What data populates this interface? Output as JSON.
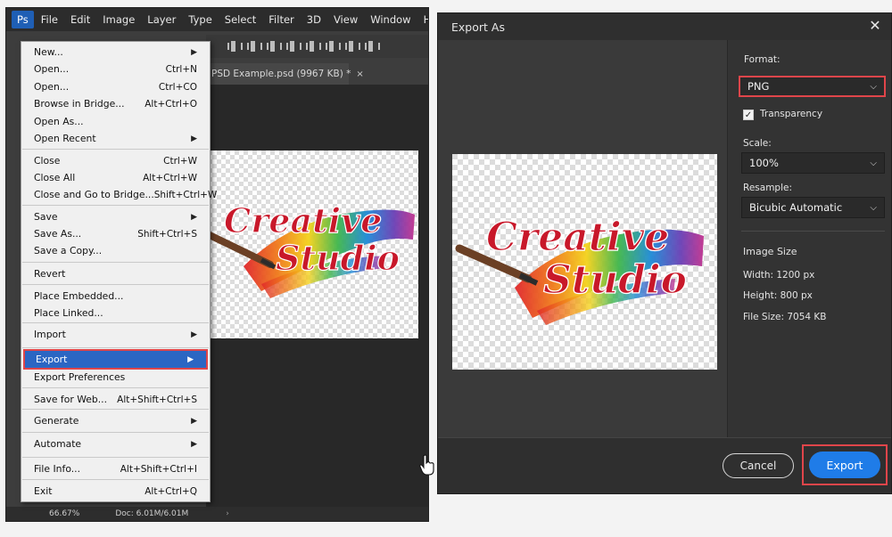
{
  "photoshop": {
    "menubar": [
      "Ps",
      "File",
      "Edit",
      "Image",
      "Layer",
      "Type",
      "Select",
      "Filter",
      "3D",
      "View",
      "Window",
      "Help"
    ],
    "document_tab": {
      "title": "PSD Example.psd (9967 KB) *",
      "close": "×"
    },
    "status": {
      "zoom": "66.67%",
      "doc": "Doc: 6.01M/6.01M",
      "arrow": "›"
    },
    "file_menu": [
      {
        "label": "New...",
        "shortcut": "",
        "submenu": true
      },
      {
        "label": "Open...",
        "shortcut": "Ctrl+N"
      },
      {
        "label": "Open...",
        "shortcut": "Ctrl+CO"
      },
      {
        "label": "Browse in Bridge...",
        "shortcut": "Alt+Ctrl+O"
      },
      {
        "label": "Open As...",
        "shortcut": ""
      },
      {
        "label": "Open Recent",
        "shortcut": "",
        "submenu": true
      },
      {
        "label": "Close",
        "shortcut": "Ctrl+W"
      },
      {
        "label": "Close All",
        "shortcut": "Alt+Ctrl+W"
      },
      {
        "label": "Close and Go to Bridge...",
        "shortcut": "Shift+Ctrl+W"
      },
      {
        "label": "Save",
        "shortcut": "",
        "submenu": true
      },
      {
        "label": "Save As...",
        "shortcut": "Shift+Ctrl+S"
      },
      {
        "label": "Save a Copy...",
        "shortcut": ""
      },
      {
        "label": "Revert",
        "shortcut": ""
      },
      {
        "label": "Place Embedded...",
        "shortcut": ""
      },
      {
        "label": "Place Linked...",
        "shortcut": ""
      },
      {
        "label": "Import",
        "shortcut": "",
        "submenu": true
      },
      {
        "label": "Export",
        "shortcut": "",
        "submenu": true,
        "highlighted": true
      },
      {
        "label": "Export Preferences",
        "shortcut": ""
      },
      {
        "label": "Save for Web...",
        "shortcut": "Alt+Shift+Ctrl+S"
      },
      {
        "label": "Generate",
        "shortcut": "",
        "submenu": true
      },
      {
        "label": "Automate",
        "shortcut": "",
        "submenu": true
      },
      {
        "label": "File Info...",
        "shortcut": "Alt+Shift+Ctrl+I"
      },
      {
        "label": "Exit",
        "shortcut": "Alt+Ctrl+Q"
      }
    ],
    "submenu_arrow": "▶"
  },
  "artwork": {
    "line1": "Creative",
    "line2": "Studio"
  },
  "export_dialog": {
    "title": "Export As",
    "close": "✕",
    "format_label": "Format:",
    "format_value": "PNG",
    "transparency_label": "Transparency",
    "transparency_checked": "✓",
    "scale_label": "Scale:",
    "scale_value": "100%",
    "resample_label": "Resample:",
    "resample_value": "Bicubic Automatic",
    "image_size_heading": "Image Size",
    "width": "Width: 1200 px",
    "height": "Height: 800 px",
    "file_size": "File Size: 7054 KB",
    "cancel_label": "Cancel",
    "export_label": "Export",
    "chevron": "⌵"
  },
  "colors": {
    "highlight_blue": "#2b66c3",
    "callout_red": "#e0454a",
    "export_blue": "#1f7ce8",
    "text_red": "#c8182a"
  }
}
